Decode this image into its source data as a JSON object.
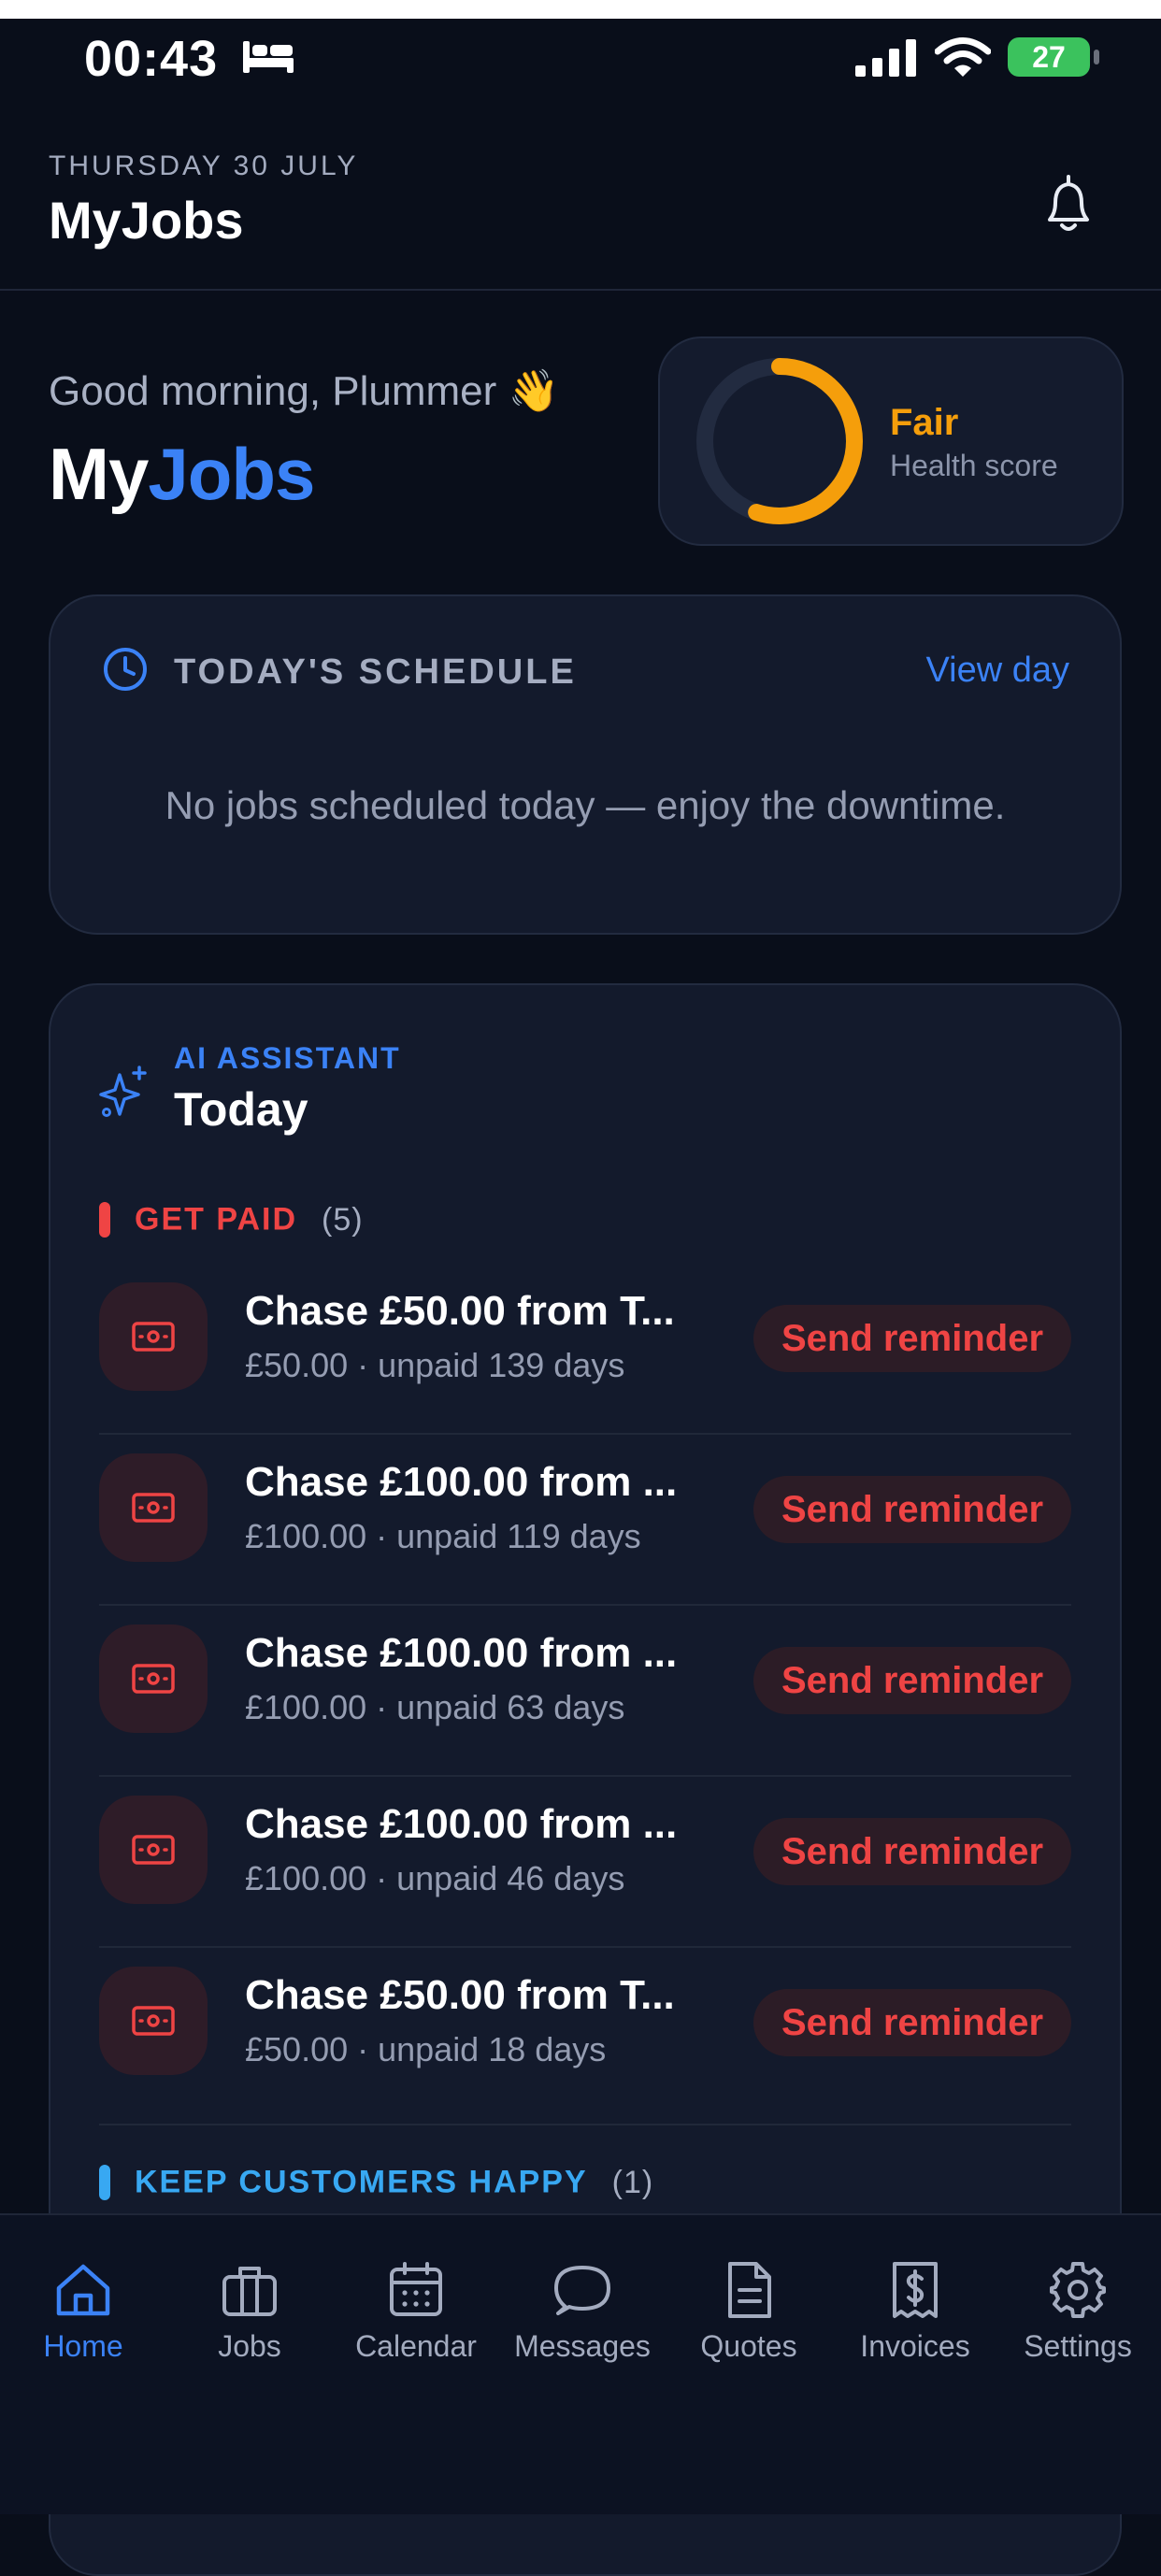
{
  "status_bar": {
    "time": "00:43",
    "battery": "27"
  },
  "header": {
    "date": "THURSDAY 30 JULY",
    "title": "MyJobs"
  },
  "greeting": {
    "text": "Good morning, Plummer 👋",
    "brand_part1": "My",
    "brand_part2": "Jobs"
  },
  "health": {
    "label": "Fair",
    "sublabel": "Health score",
    "score_fraction": 0.55,
    "color": "#f59e0b"
  },
  "schedule": {
    "title": "TODAY'S SCHEDULE",
    "view_link": "View day",
    "empty_text": "No jobs scheduled today — enjoy the downtime."
  },
  "ai": {
    "kicker": "AI ASSISTANT",
    "title": "Today",
    "get_paid": {
      "label": "GET PAID",
      "count": "(5)",
      "items": [
        {
          "title": "Chase £50.00 from T...",
          "sub": "£50.00 · unpaid 139 days",
          "action": "Send reminder"
        },
        {
          "title": "Chase £100.00 from ...",
          "sub": "£100.00 · unpaid 119 days",
          "action": "Send reminder"
        },
        {
          "title": "Chase £100.00 from ...",
          "sub": "£100.00 · unpaid 63 days",
          "action": "Send reminder"
        },
        {
          "title": "Chase £100.00 from ...",
          "sub": "£100.00 · unpaid 46 days",
          "action": "Send reminder"
        },
        {
          "title": "Chase £50.00 from T...",
          "sub": "£50.00 · unpaid 18 days",
          "action": "Send reminder"
        }
      ]
    },
    "keep_happy": {
      "label": "KEEP CUSTOMERS HAPPY",
      "count": "(1)"
    }
  },
  "tabs": [
    {
      "label": "Home",
      "icon": "home-icon",
      "active": true
    },
    {
      "label": "Jobs",
      "icon": "briefcase-icon"
    },
    {
      "label": "Calendar",
      "icon": "calendar-icon"
    },
    {
      "label": "Messages",
      "icon": "message-icon"
    },
    {
      "label": "Quotes",
      "icon": "document-icon"
    },
    {
      "label": "Invoices",
      "icon": "receipt-icon"
    },
    {
      "label": "Settings",
      "icon": "gear-icon"
    }
  ],
  "colors": {
    "accent": "#3b82f6",
    "danger": "#ef4444",
    "warning": "#f59e0b",
    "info": "#38a8f2",
    "background": "#090e1a",
    "card": "#131a2c"
  }
}
